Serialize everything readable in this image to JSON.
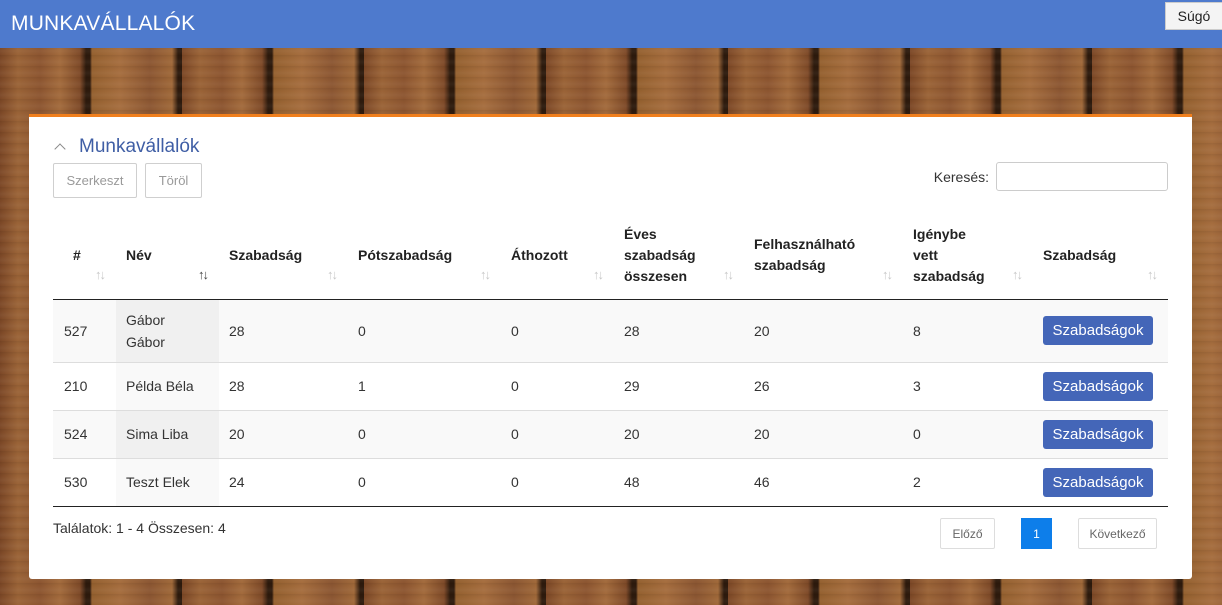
{
  "app": {
    "title": "MUNKAVÁLLALÓK",
    "help_label": "Súgó"
  },
  "panel": {
    "title": "Munkavállalók",
    "edit_label": "Szerkeszt",
    "delete_label": "Töröl",
    "search_label": "Keresés:",
    "search_value": ""
  },
  "colors": {
    "topbar": "#4e7acd",
    "accent": "#f07f1d",
    "button": "#4466b8",
    "page_active": "#0d7eea"
  },
  "table": {
    "headers": [
      "#",
      "Név",
      "Szabadság",
      "Pótszabadság",
      "Áthozott",
      "Éves szabadság összesen",
      "Felhasználható szabadság",
      "Igénybe vett szabadság",
      "Szabadság"
    ],
    "sorted_column": "Név",
    "rows": [
      {
        "id": "527",
        "name": "Gábor Gábor",
        "leave": "28",
        "extra": "0",
        "carried": "0",
        "annual_total": "28",
        "usable": "20",
        "used": "8",
        "action": "Szabadságok"
      },
      {
        "id": "210",
        "name": "Példa Béla",
        "leave": "28",
        "extra": "1",
        "carried": "0",
        "annual_total": "29",
        "usable": "26",
        "used": "3",
        "action": "Szabadságok"
      },
      {
        "id": "524",
        "name": "Sima Liba",
        "leave": "20",
        "extra": "0",
        "carried": "0",
        "annual_total": "20",
        "usable": "20",
        "used": "0",
        "action": "Szabadságok"
      },
      {
        "id": "530",
        "name": "Teszt Elek",
        "leave": "24",
        "extra": "0",
        "carried": "0",
        "annual_total": "48",
        "usable": "46",
        "used": "2",
        "action": "Szabadságok"
      }
    ]
  },
  "footer": {
    "results_text": "Találatok: 1 - 4 Összesen: 4",
    "prev_label": "Előző",
    "current_page": "1",
    "next_label": "Következő"
  }
}
